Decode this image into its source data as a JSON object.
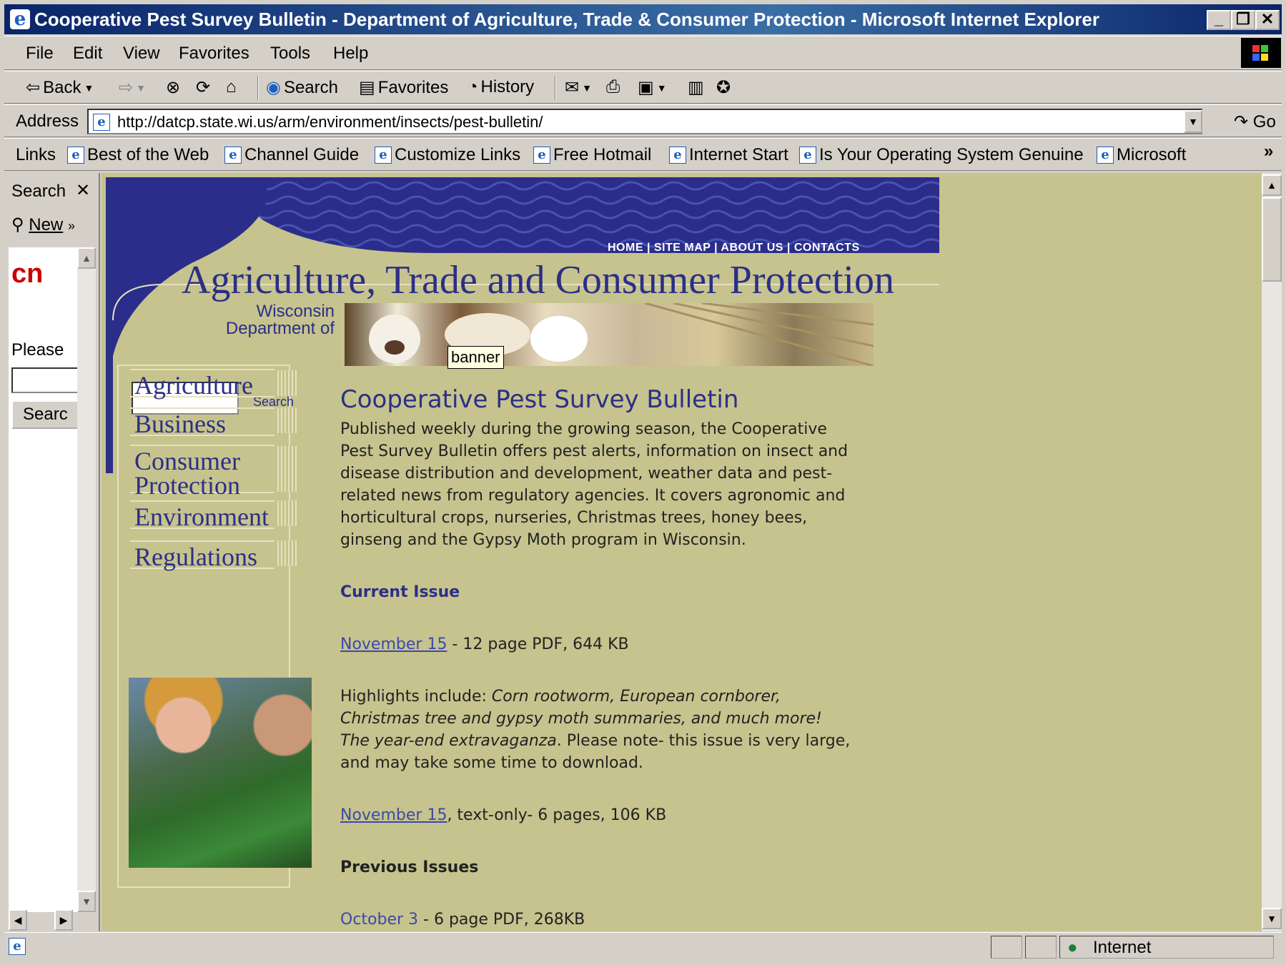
{
  "window": {
    "title": "Cooperative Pest Survey Bulletin - Department of Agriculture, Trade & Consumer Protection - Microsoft Internet Explorer"
  },
  "menu": [
    "File",
    "Edit",
    "View",
    "Favorites",
    "Tools",
    "Help"
  ],
  "toolbar": {
    "back": "Back",
    "search": "Search",
    "favorites": "Favorites",
    "history": "History"
  },
  "address": {
    "label": "Address",
    "url": "http://datcp.state.wi.us/arm/environment/insects/pest-bulletin/",
    "go": "Go"
  },
  "links": {
    "label": "Links",
    "items": [
      "Best of the Web",
      "Channel Guide",
      "Customize Links",
      "Free Hotmail",
      "Internet Start",
      "Is Your Operating System Genuine",
      "Microsoft"
    ]
  },
  "explorer_bar": {
    "title": "Search",
    "new": "New",
    "logo": "cn",
    "please": "Please",
    "search_button": "Searc"
  },
  "site": {
    "topnav": "HOME | SITE MAP | ABOUT US | CONTACTS",
    "title": "Agriculture, Trade and Consumer Protection",
    "dept_line1": "Wisconsin",
    "dept_line2": "Department of",
    "tooltip": "banner",
    "search_label": "Search",
    "nav": [
      "Agriculture",
      "Business",
      "Consumer Protection",
      "Environment",
      "Regulations"
    ]
  },
  "content": {
    "heading": "Cooperative Pest Survey Bulletin",
    "intro": "Published weekly during the growing season, the Cooperative Pest Survey Bulletin offers pest alerts, information on insect and disease distribution and development, weather data and pest-related news from regulatory agencies. It covers agronomic and horticultural crops, nurseries, Christmas trees, honey bees, ginseng and the Gypsy Moth program in Wisconsin.",
    "current_issue": "Current Issue",
    "issue1_link": "November 15",
    "issue1_desc": " - 12 page PDF, 644 KB",
    "highlights_prefix": "Highlights include: ",
    "highlights_italic": "Corn rootworm, European cornborer, Christmas tree and gypsy moth summaries, and much more! The year-end extravaganza",
    "highlights_suffix": ". Please note- this issue is very large, and may take some time to download.",
    "issue2_link": "November 15",
    "issue2_desc": ", text-only- 6 pages, 106 KB",
    "previous_issues": "Previous Issues",
    "prev1_link": "October 3",
    "prev1_desc": " - 6 page PDF, 268KB"
  },
  "status": {
    "zone": "Internet"
  }
}
